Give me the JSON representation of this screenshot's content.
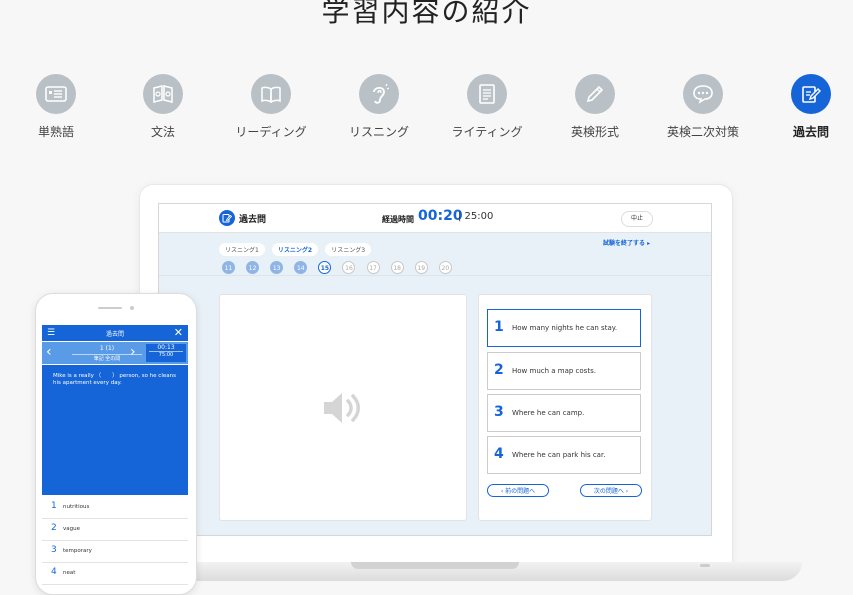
{
  "page": {
    "title": "学習内容の紹介"
  },
  "categories": [
    {
      "label": "単熟語",
      "icon": "card-icon",
      "active": false
    },
    {
      "label": "文法",
      "icon": "book-open-icon",
      "active": false
    },
    {
      "label": "リーディング",
      "icon": "open-book-icon",
      "active": false
    },
    {
      "label": "リスニング",
      "icon": "ear-icon",
      "active": false
    },
    {
      "label": "ライティング",
      "icon": "document-icon",
      "active": false
    },
    {
      "label": "英検形式",
      "icon": "pencil-icon",
      "active": false
    },
    {
      "label": "英検二次対策",
      "icon": "speech-bubble-icon",
      "active": false
    },
    {
      "label": "過去問",
      "icon": "edit-document-icon",
      "active": true
    }
  ],
  "laptop": {
    "app_name": "過去問",
    "timer_label": "経過時間",
    "timer_value": "00:20",
    "timer_total": "| 25:00",
    "pause_label": "中止",
    "tabs": [
      {
        "label": "リスニング1",
        "active": false
      },
      {
        "label": "リスニング2",
        "active": true
      },
      {
        "label": "リスニング3",
        "active": false
      }
    ],
    "finish_label": "試験を終了する ▸",
    "question_numbers": [
      {
        "n": "11",
        "state": "done"
      },
      {
        "n": "12",
        "state": "done"
      },
      {
        "n": "13",
        "state": "done"
      },
      {
        "n": "14",
        "state": "done"
      },
      {
        "n": "15",
        "state": "current"
      },
      {
        "n": "16",
        "state": "todo"
      },
      {
        "n": "17",
        "state": "todo"
      },
      {
        "n": "18",
        "state": "todo"
      },
      {
        "n": "19",
        "state": "todo"
      },
      {
        "n": "20",
        "state": "todo"
      }
    ],
    "choices": [
      {
        "num": "1",
        "text": "How many nights he can stay.",
        "selected": true
      },
      {
        "num": "2",
        "text": "How much a map costs.",
        "selected": false
      },
      {
        "num": "3",
        "text": "Where he can camp.",
        "selected": false
      },
      {
        "num": "4",
        "text": "Where he can park his car.",
        "selected": false
      }
    ],
    "prev_label": "前の問題へ",
    "next_label": "次の問題へ"
  },
  "phone": {
    "header_title": "過去問",
    "question_num": "1 (1)",
    "question_sub": "筆記 全の問",
    "time": "00:13",
    "time_total": "75:00",
    "question_text": "Mike is a really （　　） person, so he cleans his apartment every day.",
    "options": [
      {
        "num": "1",
        "word": "nutritious"
      },
      {
        "num": "2",
        "word": "vague"
      },
      {
        "num": "3",
        "word": "temporary"
      },
      {
        "num": "4",
        "word": "neat"
      }
    ]
  },
  "colors": {
    "accent": "#1565d8",
    "icon_gray": "#b9c1c6",
    "background": "#f7f7f7"
  }
}
